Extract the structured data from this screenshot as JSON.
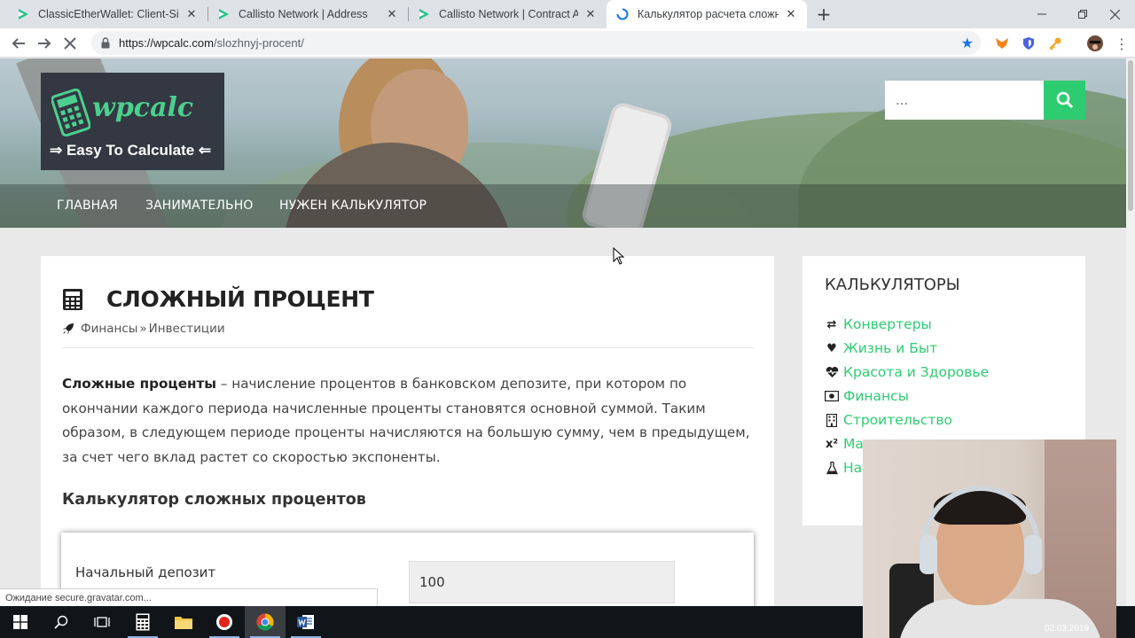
{
  "browser": {
    "tabs": [
      {
        "label": "ClassicEtherWallet: Client-Side Cl",
        "icon": "cew-icon",
        "active": false
      },
      {
        "label": "Callisto Network | Address",
        "icon": "callisto-icon",
        "active": false
      },
      {
        "label": "Callisto Network | Contract Addre",
        "icon": "callisto-icon",
        "active": false
      },
      {
        "label": "Калькулятор расчета сложного",
        "icon": "loading-spinner-icon",
        "active": true
      }
    ],
    "url_host": "https://wpcalc.com",
    "url_path": "/slozhnyj-procent/"
  },
  "site": {
    "logo_text": "wpcalc",
    "tagline": "⇒ Easy To Calculate ⇐",
    "search_placeholder": "...",
    "nav": [
      "ГЛАВНАЯ",
      "ЗАНИМАТЕЛЬНО",
      "НУЖЕН КАЛЬКУЛЯТОР"
    ],
    "accent": "#2ecc71"
  },
  "article": {
    "title": "СЛОЖНЫЙ ПРОЦЕНТ",
    "breadcrumb": [
      "Финансы",
      "»",
      "Инвестиции"
    ],
    "intro_bold": "Сложные проценты",
    "intro_rest": " – начисление процентов в банковском депозите, при котором по окончании каждого периода начисленные проценты становятся основной суммой. Таким образом, в следующем периоде проценты начисляются на большую сумму, чем в предыдущем, за счет чего вклад растет со скоростью экспоненты.",
    "calc_heading": "Калькулятор сложных процентов",
    "deposit_label": "Начальный депозит",
    "deposit_value": "100"
  },
  "sidebar": {
    "title": "КАЛЬКУЛЯТОРЫ",
    "items": [
      {
        "label": "Конвертеры",
        "icon": "arrows-exchange-icon"
      },
      {
        "label": "Жизнь и Быт",
        "icon": "heart-icon"
      },
      {
        "label": "Красота и Здоровье",
        "icon": "heartbeat-icon"
      },
      {
        "label": "Финансы",
        "icon": "money-icon"
      },
      {
        "label": "Строительство",
        "icon": "building-icon"
      },
      {
        "label": "Математика",
        "icon": "superscript-icon",
        "glyph": "x²"
      },
      {
        "label": "Наука",
        "icon": "flask-icon"
      }
    ]
  },
  "status": "Ожидание secure.gravatar.com...",
  "webcam_date": "02.03.2019"
}
